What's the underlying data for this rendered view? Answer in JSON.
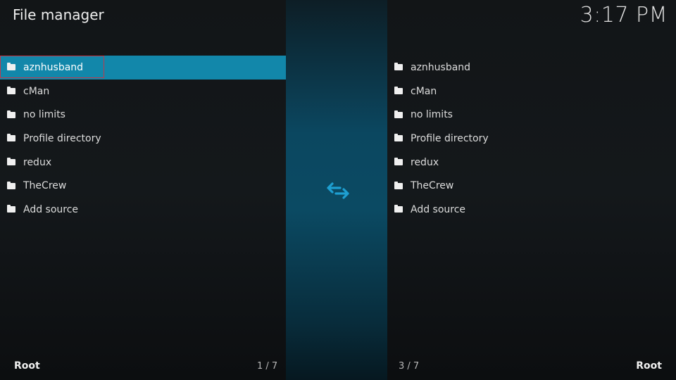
{
  "header": {
    "title": "File manager",
    "clock": "3:17 PM"
  },
  "left_pane": {
    "items": [
      "aznhusband",
      "cMan",
      "no limits",
      "Profile directory",
      "redux",
      "TheCrew",
      "Add source"
    ],
    "selected_index": 0,
    "path_label": "Root",
    "count": "1 / 7"
  },
  "right_pane": {
    "items": [
      "aznhusband",
      "cMan",
      "no limits",
      "Profile directory",
      "redux",
      "TheCrew",
      "Add source"
    ],
    "path_label": "Root",
    "count": "3 / 7"
  },
  "center": {
    "icon": "swap-arrows-icon",
    "accent": "#1e9fd1"
  },
  "colors": {
    "selected_bg": "#1287aa",
    "focus_border": "#c0394b"
  }
}
